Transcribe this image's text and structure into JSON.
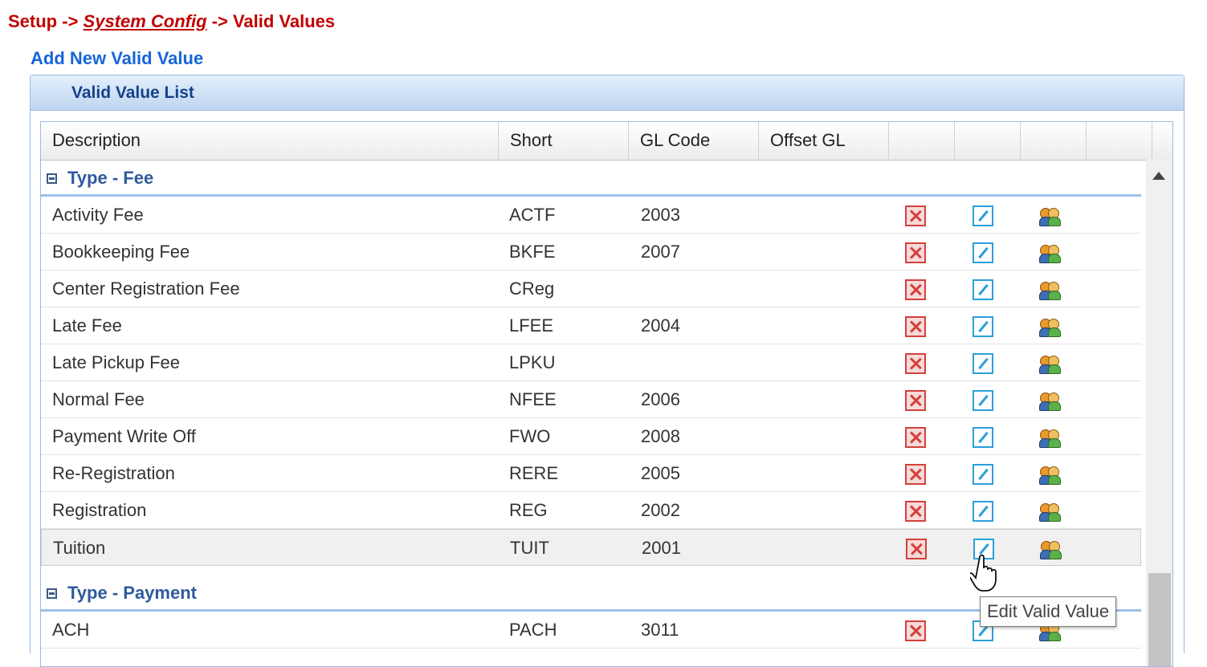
{
  "breadcrumb": {
    "setup": "Setup",
    "sep1": " -> ",
    "system_config": "System Config",
    "sep2": " -> ",
    "current": "Valid Values"
  },
  "add_link": "Add New Valid Value",
  "panel": {
    "title": "Valid Value List"
  },
  "grid": {
    "columns": [
      "Description",
      "Short",
      "GL Code",
      "Offset GL"
    ],
    "groups": [
      {
        "label": "Type - Fee",
        "rows": [
          {
            "description": "Activity Fee",
            "short": "ACTF",
            "gl_code": "2003"
          },
          {
            "description": "Bookkeeping Fee",
            "short": "BKFE",
            "gl_code": "2007"
          },
          {
            "description": "Center Registration Fee",
            "short": "CReg",
            "gl_code": ""
          },
          {
            "description": "Late Fee",
            "short": "LFEE",
            "gl_code": "2004"
          },
          {
            "description": "Late Pickup Fee",
            "short": "LPKU",
            "gl_code": ""
          },
          {
            "description": "Normal Fee",
            "short": "NFEE",
            "gl_code": "2006"
          },
          {
            "description": "Payment Write Off",
            "short": "FWO",
            "gl_code": "2008"
          },
          {
            "description": "Re-Registration",
            "short": "RERE",
            "gl_code": "2005"
          },
          {
            "description": "Registration",
            "short": "REG",
            "gl_code": "2002"
          },
          {
            "description": "Tuition",
            "short": "TUIT",
            "gl_code": "2001"
          }
        ]
      },
      {
        "label": "Type - Payment",
        "rows": [
          {
            "description": "ACH",
            "short": "PACH",
            "gl_code": "3011"
          }
        ]
      }
    ]
  },
  "icons": {
    "delete": "delete-icon",
    "edit": "edit-icon",
    "users": "users-icon",
    "collapse": "collapse-icon",
    "scroll_up": "scroll-up-icon",
    "cursor": "hand-cursor-icon"
  },
  "tooltip": "Edit Valid Value",
  "colors": {
    "breadcrumb": "#c00000",
    "link": "#1565d8",
    "group_label": "#2f5a9c",
    "panel_title": "#15428b"
  }
}
